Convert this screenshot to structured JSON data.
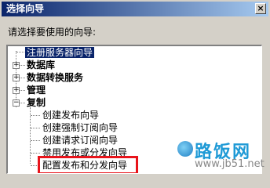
{
  "window": {
    "title": "选择向导",
    "close_glyph": "×"
  },
  "prompt": "请选择要使用的向导:",
  "tree": {
    "items": [
      {
        "label": "注册服务器向导",
        "expander": "",
        "selected": true
      },
      {
        "label": "数据库",
        "expander": "+",
        "bold": true
      },
      {
        "label": "数据转换服务",
        "expander": "+",
        "bold": true
      },
      {
        "label": "管理",
        "expander": "+",
        "bold": true
      },
      {
        "label": "复制",
        "expander": "−",
        "bold": true
      },
      {
        "label": "创建发布向导"
      },
      {
        "label": "创建强制订阅向导"
      },
      {
        "label": "创建请求订阅向导"
      },
      {
        "label": "禁用发布或分发向导"
      },
      {
        "label": "配置发布和分发向导",
        "highlighted": true
      }
    ]
  },
  "watermark": {
    "name": "路饭网",
    "url": "www.jb51.net"
  },
  "colors": {
    "titlebar_start": "#0a246a",
    "highlight": "#e8141b",
    "watermark": "#1f9ad6"
  }
}
